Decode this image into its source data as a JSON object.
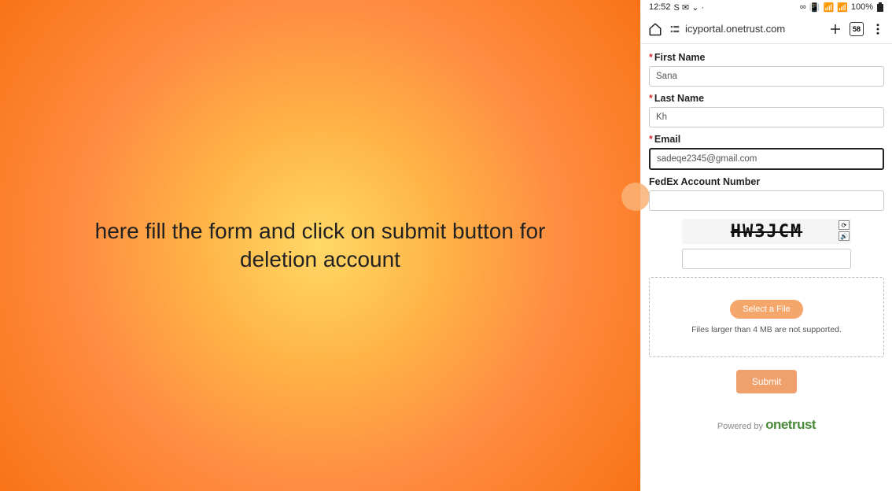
{
  "left": {
    "instruction_line1": "here fill the form and click on submit button for",
    "instruction_line2": "deletion account"
  },
  "status": {
    "time": "12:52",
    "battery": "100%",
    "indicators": "S ✉ ⌄ ·"
  },
  "url_bar": {
    "domain": "icyportal.onetrust.com",
    "tab_count": "58"
  },
  "form": {
    "first_name_label": "First Name",
    "first_name_value": "Sana",
    "last_name_label": "Last Name",
    "last_name_value": "Kh",
    "email_label": "Email",
    "email_value": "sadeqe2345@gmail.com",
    "account_label": "FedEx Account Number",
    "account_value": "",
    "captcha_text": "HW3JCM",
    "select_file": "Select a File",
    "file_hint": "Files larger than 4 MB are not supported.",
    "submit": "Submit"
  },
  "footer": {
    "powered": "Powered by",
    "brand": "onetrust"
  }
}
